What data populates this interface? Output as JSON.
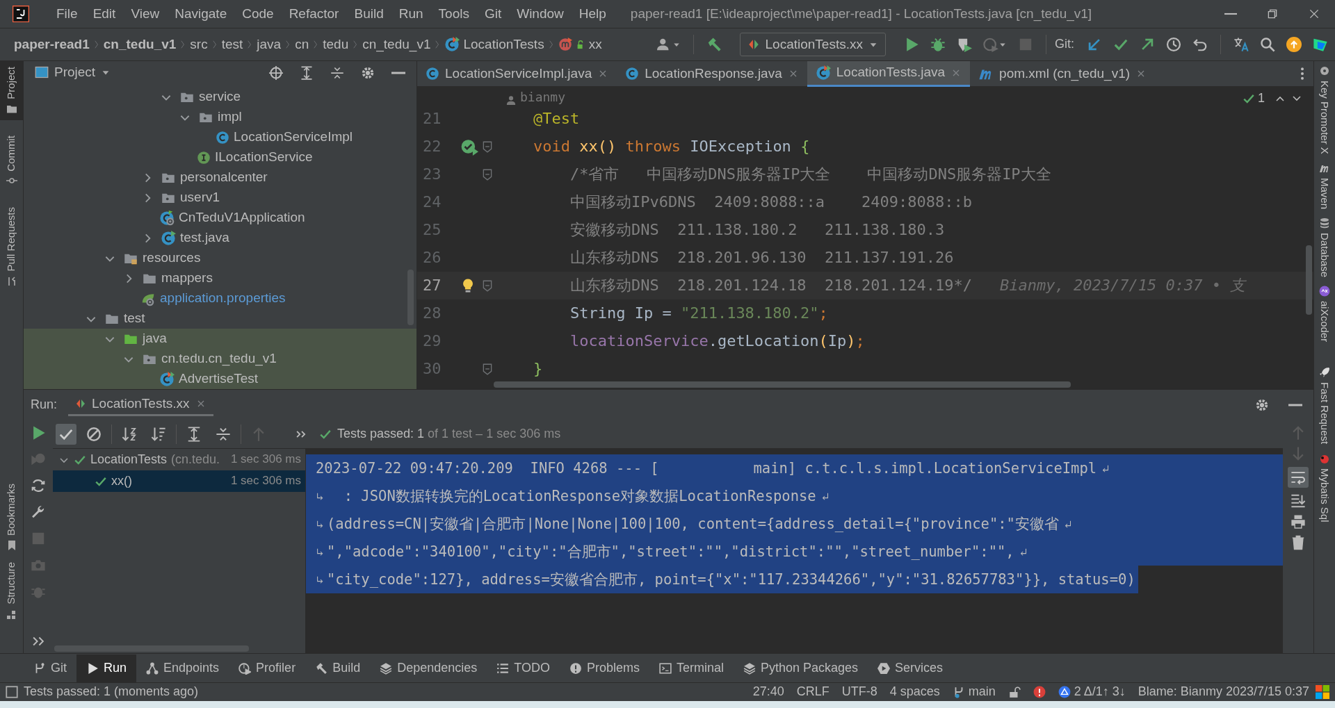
{
  "window": {
    "title": "paper-read1 [E:\\ideaproject\\me\\paper-read1] - LocationTests.java [cn_tedu_v1]"
  },
  "menu": [
    "File",
    "Edit",
    "View",
    "Navigate",
    "Code",
    "Refactor",
    "Build",
    "Run",
    "Tools",
    "Git",
    "Window",
    "Help"
  ],
  "breadcrumbs": [
    {
      "label": "paper-read1",
      "kind": "project"
    },
    {
      "label": "cn_tedu_v1",
      "kind": "project"
    },
    {
      "label": "src",
      "kind": "dir"
    },
    {
      "label": "test",
      "kind": "dir"
    },
    {
      "label": "java",
      "kind": "dir"
    },
    {
      "label": "cn",
      "kind": "dir"
    },
    {
      "label": "tedu",
      "kind": "dir"
    },
    {
      "label": "cn_tedu_v1",
      "kind": "dir"
    },
    {
      "label": "LocationTests",
      "kind": "class"
    },
    {
      "label": "xx",
      "kind": "method"
    }
  ],
  "toolbar": {
    "run_config": "LocationTests.xx",
    "vcs_label": "Git:"
  },
  "left_stripe": [
    {
      "label": "Project",
      "selected": true
    },
    {
      "label": "Commit",
      "selected": false
    },
    {
      "label": "Pull Requests",
      "selected": false
    },
    {
      "label": "Bookmarks",
      "selected": false
    },
    {
      "label": "Structure",
      "selected": false
    }
  ],
  "right_stripe": [
    "Key Promoter X",
    "Maven",
    "Database",
    "aiXcoder",
    "Fast Request",
    "Mybatis Sql"
  ],
  "project": {
    "title": "Project",
    "tree": [
      {
        "children": [
          {
            "children": [
              {
                "children": [
                  {
                    "children": [
                      {
                        "children": [
                          {
                            "label": "service",
                            "kind": "package",
                            "expanded": true,
                            "test_scope": false,
                            "children": [
                              {
                                "label": "impl",
                                "kind": "package",
                                "expanded": true,
                                "test_scope": false,
                                "children": [
                                  {
                                    "label": "LocationServiceImpl",
                                    "kind": "class",
                                    "test_scope": false
                                  }
                                ]
                              },
                              {
                                "label": "ILocationService",
                                "kind": "interface",
                                "test_scope": false
                              }
                            ]
                          }
                        ]
                      },
                      {
                        "label": "personalcenter",
                        "kind": "package",
                        "expanded": false,
                        "test_scope": false
                      },
                      {
                        "label": "userv1",
                        "kind": "package",
                        "expanded": false,
                        "test_scope": false
                      },
                      {
                        "label": "CnTeduV1Application",
                        "kind": "spring-class",
                        "test_scope": false
                      },
                      {
                        "label": "test.java",
                        "kind": "runnable-class",
                        "expanded": false,
                        "test_scope": false
                      }
                    ]
                  }
                ]
              },
              {
                "label": "resources",
                "kind": "resources",
                "expanded": true,
                "test_scope": false,
                "children": [
                  {
                    "label": "mappers",
                    "kind": "folder",
                    "expanded": false,
                    "test_scope": false
                  },
                  {
                    "label": "application.properties",
                    "kind": "properties",
                    "test_scope": false
                  }
                ]
              }
            ]
          },
          {
            "label": "test",
            "kind": "folder",
            "expanded": true,
            "test_scope": false,
            "children": [
              {
                "label": "java",
                "kind": "test-root",
                "expanded": true,
                "test_scope": true,
                "children": [
                  {
                    "label": "cn.tedu.cn_tedu_v1",
                    "kind": "package",
                    "expanded": true,
                    "test_scope": true,
                    "children": [
                      {
                        "label": "AdvertiseTest",
                        "kind": "test-class",
                        "test_scope": true
                      }
                    ]
                  }
                ]
              }
            ]
          }
        ]
      }
    ]
  },
  "editor": {
    "tabs": [
      {
        "label": "LocationServiceImpl.java",
        "kind": "class",
        "selected": false
      },
      {
        "label": "LocationResponse.java",
        "kind": "class",
        "selected": false
      },
      {
        "label": "LocationTests.java",
        "kind": "test-class",
        "selected": true
      },
      {
        "label": "pom.xml (cn_tedu_v1)",
        "kind": "maven",
        "selected": false
      }
    ],
    "author_hint": "bianmy",
    "inspections": "1",
    "lines": [
      {
        "number": "21",
        "current": false,
        "tokens": [
          {
            "kind": "annotation",
            "text": "    @Test"
          }
        ]
      },
      {
        "number": "22",
        "current": false,
        "runnable": true,
        "foldable": true,
        "tokens": [
          {
            "kind": "keyword",
            "text": "    void "
          },
          {
            "kind": "function",
            "text": "xx()"
          },
          {
            "kind": "keyword",
            "text": " throws "
          },
          {
            "kind": "plain",
            "text": "IOException "
          },
          {
            "kind": "brace",
            "text": "{"
          }
        ]
      },
      {
        "number": "23",
        "current": false,
        "foldable": true,
        "tokens": [
          {
            "kind": "comment",
            "text": "        /*省市   中国移动DNS服务器IP大全    中国移动DNS服务器IP大全"
          }
        ]
      },
      {
        "number": "24",
        "current": false,
        "tokens": [
          {
            "kind": "comment",
            "text": "        中国移动IPv6DNS  2409:8088::a    2409:8088::b"
          }
        ]
      },
      {
        "number": "25",
        "current": false,
        "tokens": [
          {
            "kind": "comment",
            "text": "        安徽移动DNS  211.138.180.2   211.138.180.3"
          }
        ]
      },
      {
        "number": "26",
        "current": false,
        "tokens": [
          {
            "kind": "comment",
            "text": "        山东移动DNS  218.201.96.130  211.137.191.26"
          }
        ]
      },
      {
        "number": "27",
        "current": true,
        "foldable": true,
        "intention": true,
        "tokens": [
          {
            "kind": "comment",
            "text": "        山东移动DNS  218.201.124.18  218.201.124.19*/"
          }
        ],
        "inlay": "Bianmy, 2023/7/15 0:37 • 支"
      },
      {
        "number": "28",
        "current": false,
        "tokens": [
          {
            "kind": "plain",
            "text": "        String Ip = "
          },
          {
            "kind": "string",
            "text": "\"211.138.180.2\""
          },
          {
            "kind": "keyword",
            "text": ";"
          }
        ]
      },
      {
        "number": "29",
        "current": false,
        "tokens": [
          {
            "kind": "field",
            "text": "        locationService"
          },
          {
            "kind": "plain",
            "text": ".getLocation"
          },
          {
            "kind": "function",
            "text": "("
          },
          {
            "kind": "plain",
            "text": "Ip"
          },
          {
            "kind": "function",
            "text": ")"
          },
          {
            "kind": "keyword",
            "text": ";"
          }
        ]
      },
      {
        "number": "30",
        "current": false,
        "foldable": true,
        "tokens": [
          {
            "kind": "brace",
            "text": "    }"
          }
        ]
      }
    ]
  },
  "run": {
    "label": "Run:",
    "tab": "LocationTests.xx",
    "summary": "Tests passed: 1",
    "summary_detail": "of 1 test – 1 sec 306 ms",
    "tests": [
      {
        "label": "LocationTests",
        "detail": "(cn.tedu.",
        "time": "1 sec 306 ms",
        "passed": true,
        "expanded": true,
        "selected": false,
        "children": [
          {
            "label": "xx()",
            "time": "1 sec 306 ms",
            "passed": true,
            "selected": true
          }
        ]
      }
    ],
    "console": [
      {
        "text": "2023-07-22 09:47:20.209  INFO 4268 --- [           main] c.t.c.l.s.impl.LocationServiceImpl",
        "continuation": false,
        "wrapped": true,
        "selected": true
      },
      {
        "text": "  : JSON数据转换完的LocationResponse对象数据LocationResponse",
        "continuation": true,
        "wrapped": true,
        "selected": true
      },
      {
        "text": "(address=CN|安徽省|合肥市|None|None|100|100, content={address_detail={\"province\":\"安徽省",
        "continuation": true,
        "wrapped": true,
        "selected": true
      },
      {
        "text": "\",\"adcode\":\"340100\",\"city\":\"合肥市\",\"street\":\"\",\"district\":\"\",\"street_number\":\"\",",
        "continuation": true,
        "wrapped": true,
        "selected": true
      },
      {
        "text": "\"city_code\":127}, address=安徽省合肥市, point={\"x\":\"117.23344266\",\"y\":\"31.82657783\"}}, status=0)",
        "continuation": true,
        "wrapped": false,
        "selected": true
      }
    ]
  },
  "tool_tabs": [
    {
      "label": "Git",
      "kind": "git",
      "selected": false
    },
    {
      "label": "Run",
      "kind": "run",
      "selected": true
    },
    {
      "label": "Endpoints",
      "kind": "endpoints",
      "selected": false
    },
    {
      "label": "Profiler",
      "kind": "profiler",
      "selected": false
    },
    {
      "label": "Build",
      "kind": "build",
      "selected": false
    },
    {
      "label": "Dependencies",
      "kind": "layers",
      "selected": false
    },
    {
      "label": "TODO",
      "kind": "list",
      "selected": false
    },
    {
      "label": "Problems",
      "kind": "problems",
      "selected": false
    },
    {
      "label": "Terminal",
      "kind": "terminal",
      "selected": false
    },
    {
      "label": "Python Packages",
      "kind": "layers",
      "selected": false
    },
    {
      "label": "Services",
      "kind": "services",
      "selected": false
    }
  ],
  "status_bar": {
    "message": "Tests passed: 1 (moments ago)",
    "position": "27:40",
    "line_separator": "CRLF",
    "encoding": "UTF-8",
    "indent": "4 spaces",
    "branch": "main",
    "read_only": false,
    "vcs_counts": "2 Δ/1↑ 3↓",
    "blame": "Blame: Bianmy 2023/7/15 0:37"
  }
}
